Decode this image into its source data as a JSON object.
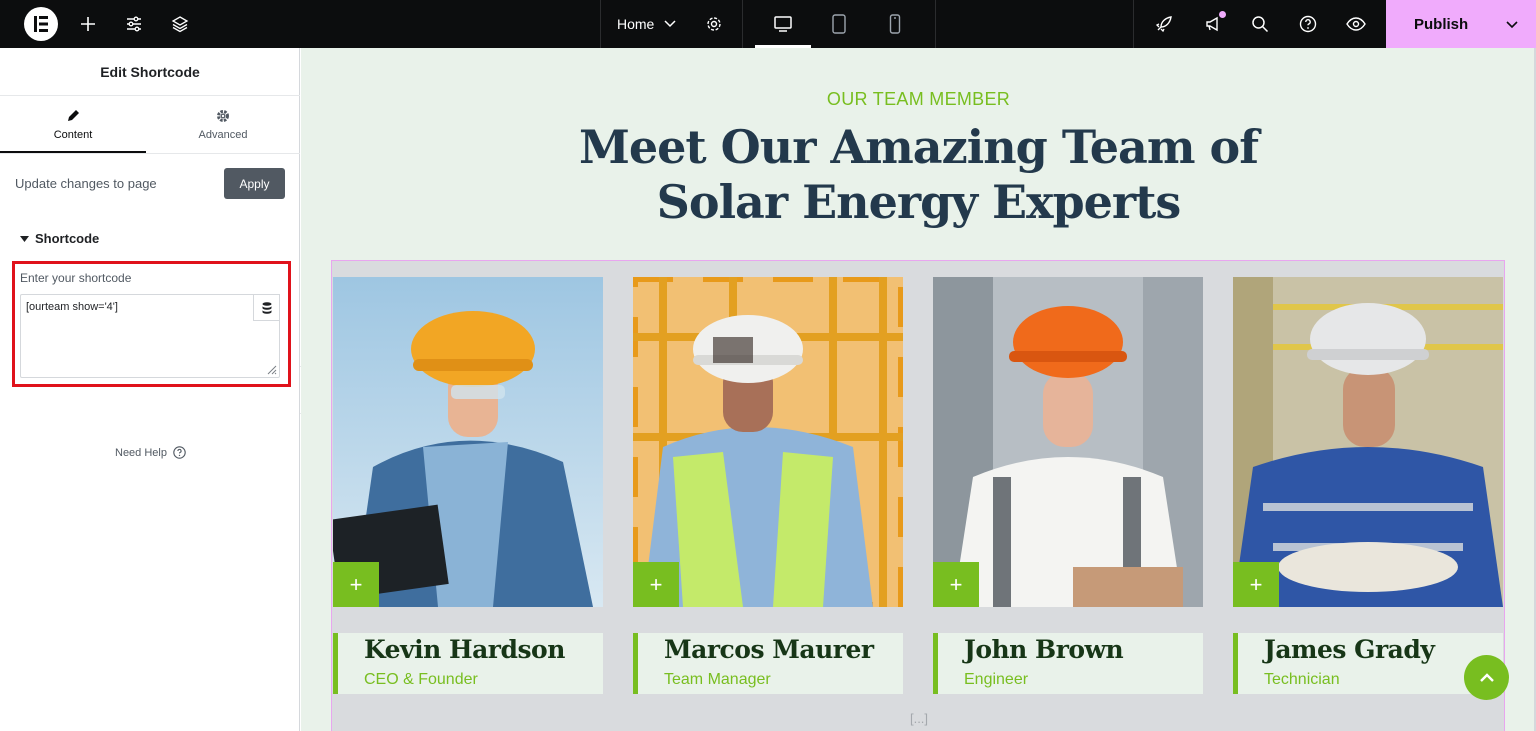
{
  "topbar": {
    "logo": "elementor-logo",
    "page_selector": "Home",
    "publish_label": "Publish",
    "icons": [
      "plus-icon",
      "sliders-icon",
      "layers-icon",
      "chevron-down-icon",
      "gear-icon",
      "desktop-icon",
      "tablet-icon",
      "mobile-icon",
      "rocket-icon",
      "megaphone-icon",
      "search-icon",
      "help-icon",
      "eye-icon"
    ],
    "accent_color": "#f0abfc"
  },
  "panel": {
    "title": "Edit Shortcode",
    "tabs": [
      {
        "label": "Content",
        "active": true,
        "icon": "pencil-icon"
      },
      {
        "label": "Advanced",
        "active": false,
        "icon": "gear-icon"
      }
    ],
    "update_text": "Update changes to page",
    "apply_label": "Apply",
    "section_title": "Shortcode",
    "shortcode_label": "Enter your shortcode",
    "shortcode_value": "[ourteam show='4']",
    "need_help": "Need Help"
  },
  "canvas": {
    "subtitle": "OUR TEAM MEMBER",
    "headline_line1": "Meet Our Amazing Team of",
    "headline_line2": "Solar Energy Experts",
    "members": [
      {
        "name": "Kevin Hardson",
        "role": "CEO & Founder"
      },
      {
        "name": "Marcos Maurer",
        "role": "Team Manager"
      },
      {
        "name": "John Brown",
        "role": "Engineer"
      },
      {
        "name": "James Grady",
        "role": "Technician"
      }
    ],
    "ellipsis": "[...]",
    "brand_color": "#78be20",
    "heading_color": "#23394c"
  }
}
